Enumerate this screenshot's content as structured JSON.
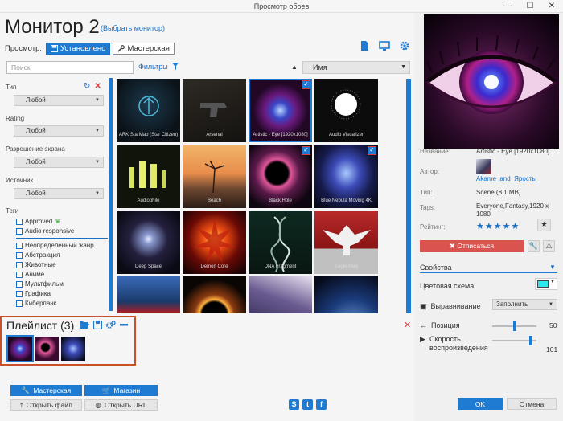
{
  "window": {
    "title": "Просмотр обоев",
    "controls": [
      "—",
      "☐",
      "✕"
    ]
  },
  "header": {
    "title": "Монитор 2",
    "choose_monitor": "(Выбрать монитор)"
  },
  "view": {
    "label": "Просмотр:",
    "tab_installed": "Установлено",
    "tab_workshop": "Мастерская"
  },
  "toolbar": {
    "search_placeholder": "Поиск",
    "filters_label": "Фильтры",
    "sort_value": "Имя"
  },
  "filters": {
    "type_label": "Тип",
    "type_value": "Любой",
    "rating_label": "Rating",
    "rating_value": "Любой",
    "resolution_label": "Разрешение экрана",
    "resolution_value": "Любой",
    "source_label": "Источник",
    "source_value": "Любой",
    "tags_label": "Теги",
    "checkboxes_top": [
      "Approved",
      "Audio responsive"
    ],
    "checkboxes_tags": [
      "Неопределенный жанр",
      "Абстракция",
      "Животные",
      "Аниме",
      "Мультфильм",
      "Графика",
      "Киберпанк"
    ]
  },
  "wallpapers": [
    {
      "title": "ARK StarMap (Star Citizen)",
      "checked": false,
      "selected": false
    },
    {
      "title": "Arsenal",
      "checked": false,
      "selected": false
    },
    {
      "title": "Artistic - Eye [1920x1080]",
      "checked": true,
      "selected": true
    },
    {
      "title": "Audio Visualizer",
      "checked": false,
      "selected": false
    },
    {
      "title": "Audiophile",
      "checked": false,
      "selected": false
    },
    {
      "title": "Beach",
      "checked": false,
      "selected": false
    },
    {
      "title": "Black Hole",
      "checked": true,
      "selected": false
    },
    {
      "title": "Blue Nebula Moving 4K",
      "checked": true,
      "selected": false
    },
    {
      "title": "Deep Space",
      "checked": false,
      "selected": false
    },
    {
      "title": "Demon Core",
      "checked": false,
      "selected": false
    },
    {
      "title": "DNA Fragment",
      "checked": false,
      "selected": false
    },
    {
      "title": "Eagle Flag",
      "checked": false,
      "selected": false
    },
    {
      "title": "",
      "checked": false,
      "selected": false
    },
    {
      "title": "",
      "checked": false,
      "selected": false
    },
    {
      "title": "",
      "checked": false,
      "selected": false
    },
    {
      "title": "",
      "checked": false,
      "selected": false
    }
  ],
  "playlist": {
    "title": "Плейлист (3)"
  },
  "bottom_buttons": {
    "workshop": "Мастерская",
    "shop": "Магазин",
    "open_file": "Открыть файл",
    "open_url": "Открыть URL"
  },
  "details": {
    "name_label": "Название:",
    "name_value": "Artistic - Eye [1920x1080]",
    "author_label": "Автор:",
    "author_value": "Akame_and_Ярость",
    "type_label": "Тип:",
    "type_value": "Scene (8.1 MB)",
    "tags_label": "Tags:",
    "tags_value": "Everyone,Fantasy,1920 x 1080",
    "rating_label": "Рейтинг:",
    "rating_value": "★★★★★",
    "unsubscribe": "Отписаться",
    "properties": "Свойства",
    "color_scheme": "Цветовая схема",
    "color_scheme_value": "#2ee6f0",
    "alignment_label": "Выравнивание",
    "alignment_value": "Заполнить",
    "position_label": "Позиция",
    "position_value": "50",
    "speed_label": "Скорость воспроизведения",
    "speed_value": "101"
  },
  "footer": {
    "ok": "OK",
    "cancel": "Отмена"
  },
  "accent_color": "#1f7bd1"
}
